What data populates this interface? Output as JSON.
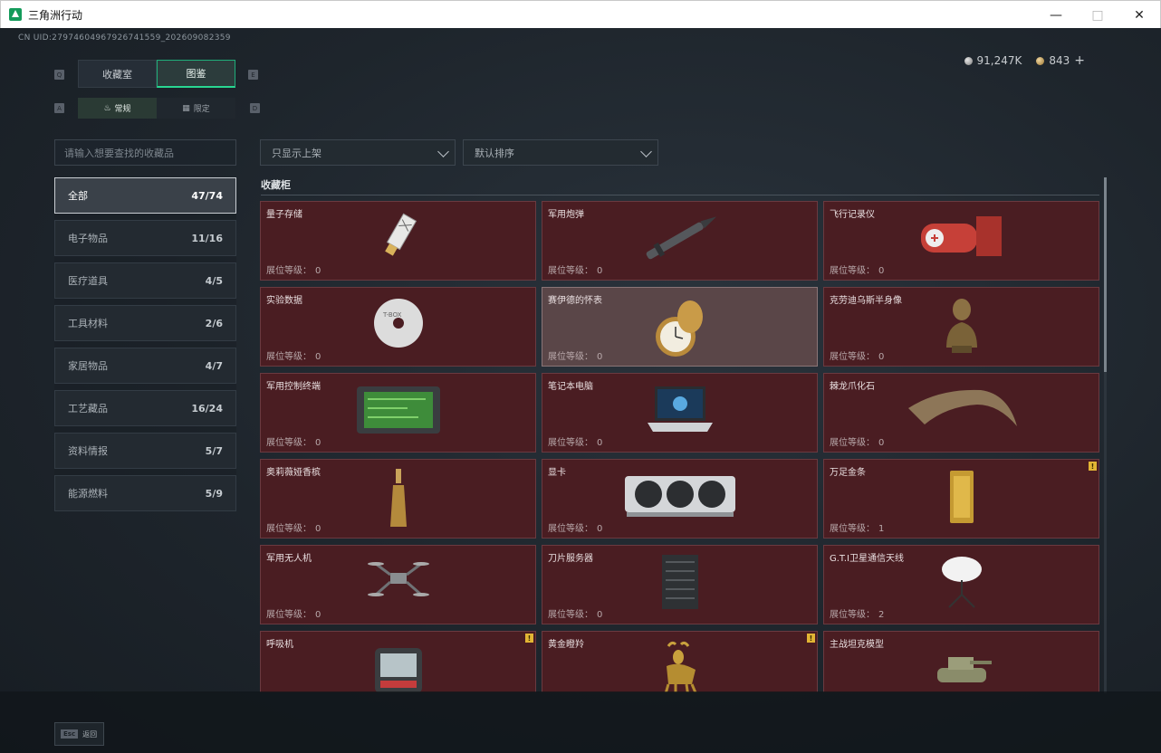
{
  "window": {
    "title": "三角洲行动",
    "minimize_icon": "minimize-icon",
    "maximize_icon": "maximize-icon",
    "close_icon": "close-icon"
  },
  "header": {
    "uid": "CN UID:27974604967926741559_202609082359",
    "currency": [
      {
        "icon": "silver-coin-icon",
        "value": "91,247K"
      },
      {
        "icon": "gold-coin-icon",
        "value": "843"
      }
    ],
    "plus_label": "+"
  },
  "tabs": {
    "key_left": "Q",
    "key_right": "E",
    "main": [
      {
        "label": "收藏室",
        "active": false
      },
      {
        "label": "图鉴",
        "active": true
      }
    ],
    "sub_key_left": "A",
    "sub_key_right": "D",
    "sub": [
      {
        "label": "常规",
        "icon": "flame-icon",
        "active": true
      },
      {
        "label": "限定",
        "icon": "grid-icon",
        "active": false
      }
    ]
  },
  "search": {
    "placeholder": "请输入想要查找的收藏品"
  },
  "filters": {
    "shelf_filter": "只显示上架",
    "sort": "默认排序"
  },
  "categories": [
    {
      "label": "全部",
      "count": "47/74",
      "active": true
    },
    {
      "label": "电子物品",
      "count": "11/16",
      "active": false
    },
    {
      "label": "医疗道具",
      "count": "4/5",
      "active": false
    },
    {
      "label": "工具材料",
      "count": "2/6",
      "active": false
    },
    {
      "label": "家居物品",
      "count": "4/7",
      "active": false
    },
    {
      "label": "工艺藏品",
      "count": "16/24",
      "active": false
    },
    {
      "label": "资料情报",
      "count": "5/7",
      "active": false
    },
    {
      "label": "能源燃料",
      "count": "5/9",
      "active": false
    }
  ],
  "cabinet": {
    "title": "收藏柜",
    "level_label": "展位等级：",
    "warn_label": "!",
    "items": [
      {
        "name": "量子存储",
        "level": "0",
        "art": "usb",
        "warn": false,
        "highlight": false
      },
      {
        "name": "军用炮弹",
        "level": "0",
        "art": "shell",
        "warn": false,
        "highlight": false
      },
      {
        "name": "飞行记录仪",
        "level": "0",
        "art": "recorder",
        "warn": false,
        "highlight": false
      },
      {
        "name": "实验数据",
        "level": "0",
        "art": "disc",
        "warn": false,
        "highlight": false
      },
      {
        "name": "赛伊德的怀表",
        "level": "0",
        "art": "watch",
        "warn": false,
        "highlight": true
      },
      {
        "name": "克劳迪乌斯半身像",
        "level": "0",
        "art": "bust",
        "warn": false,
        "highlight": false
      },
      {
        "name": "军用控制终端",
        "level": "0",
        "art": "terminal",
        "warn": false,
        "highlight": false
      },
      {
        "name": "笔记本电脑",
        "level": "0",
        "art": "laptop",
        "warn": false,
        "highlight": false
      },
      {
        "name": "棘龙爪化石",
        "level": "0",
        "art": "claw",
        "warn": false,
        "highlight": false
      },
      {
        "name": "奥莉薇娅香槟",
        "level": "0",
        "art": "bottle",
        "warn": false,
        "highlight": false
      },
      {
        "name": "显卡",
        "level": "0",
        "art": "gpu",
        "warn": false,
        "highlight": false
      },
      {
        "name": "万足金条",
        "level": "1",
        "art": "goldbar",
        "warn": true,
        "highlight": false
      },
      {
        "name": "军用无人机",
        "level": "0",
        "art": "drone",
        "warn": false,
        "highlight": false
      },
      {
        "name": "刀片服务器",
        "level": "0",
        "art": "server",
        "warn": false,
        "highlight": false
      },
      {
        "name": "G.T.I卫星通信天线",
        "level": "2",
        "art": "dish",
        "warn": false,
        "highlight": false
      },
      {
        "name": "呼吸机",
        "level": "",
        "art": "ventilator",
        "warn": true,
        "highlight": false
      },
      {
        "name": "黄金瞪羚",
        "level": "",
        "art": "gazelle",
        "warn": true,
        "highlight": false
      },
      {
        "name": "主战坦克模型",
        "level": "",
        "art": "tank",
        "warn": false,
        "highlight": false
      }
    ]
  },
  "footer": {
    "esc_key": "Esc",
    "esc_label": "返回"
  }
}
